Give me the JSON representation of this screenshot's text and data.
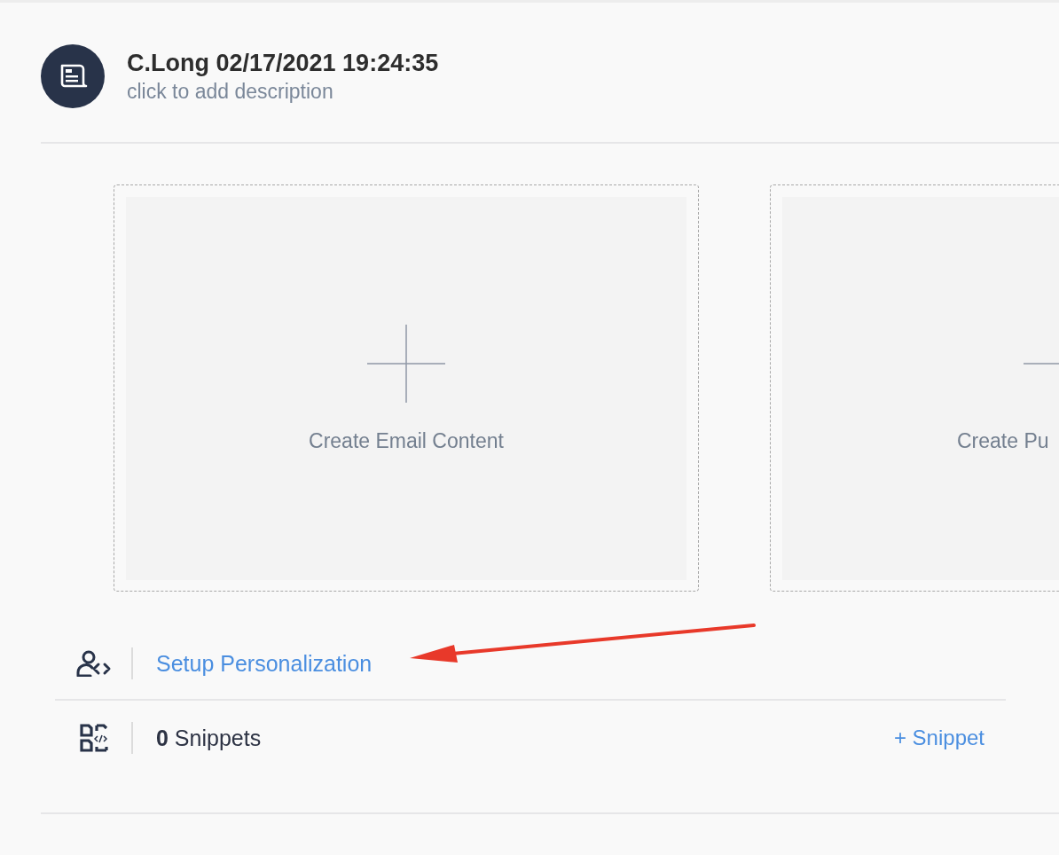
{
  "header": {
    "title": "C.Long 02/17/2021 19:24:35",
    "description_placeholder": "click to add description"
  },
  "content_cards": [
    {
      "label": "Create Email Content",
      "cut": false
    },
    {
      "label": "Create Pu",
      "cut": true
    }
  ],
  "personalization": {
    "link": "Setup Personalization"
  },
  "snippets": {
    "count_text": "**0** Snippets",
    "add_link": "+ Snippet"
  }
}
